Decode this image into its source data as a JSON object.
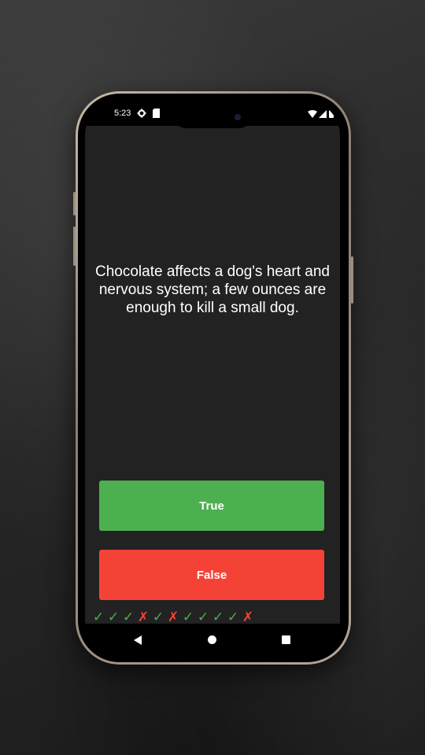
{
  "status_bar": {
    "time": "5:23",
    "icons": [
      "gear-icon",
      "sd-card-icon"
    ],
    "right_icons": [
      "wifi-icon",
      "signal-icon",
      "battery-icon"
    ]
  },
  "quiz": {
    "question": "Chocolate affects a dog's heart and nervous system; a few ounces are enough to kill a small dog.",
    "true_label": "True",
    "false_label": "False",
    "score_marks": [
      "✓",
      "✓",
      "✓",
      "✗",
      "✓",
      "✗",
      "✓",
      "✓",
      "✓",
      "✓",
      "✗"
    ],
    "colors": {
      "true": "#4caf50",
      "false": "#f44336",
      "check": "#4caf50",
      "cross": "#f44336"
    }
  },
  "nav": {
    "icons": [
      "back-icon",
      "home-icon",
      "recents-icon"
    ]
  }
}
